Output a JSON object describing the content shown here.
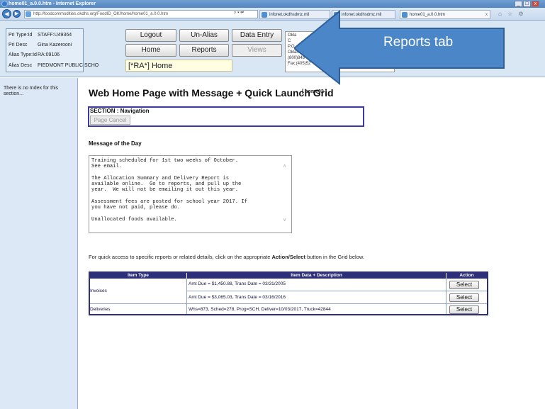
{
  "window": {
    "title": "home01_a.0.0.htm - Internet Explorer",
    "controls": {
      "minimize": "_",
      "maximize": "□",
      "close": "x"
    }
  },
  "browser": {
    "back_icon": "back-arrow-icon",
    "forward_icon": "forward-arrow-icon",
    "address": "http://foodcommodities.okdhs.org/FoodID_OK/home/home01_a.0.0.htm",
    "address_controls": "⌕ ▾  ⇄",
    "tabs": [
      {
        "label": "infonet.okdhsdmz.mil"
      },
      {
        "label": "infonet.okdhsdmz.mil"
      },
      {
        "label": "home01_a.0.0.htm",
        "close": "x"
      }
    ],
    "toolbar_icons": "⌂ ☆ ⚙"
  },
  "header": {
    "user_info": [
      {
        "label": "Pri Type:Id",
        "value": "STAFF:U49364"
      },
      {
        "label": "Pri Desc",
        "value": "Gina Kazerooni"
      },
      {
        "label": "Alias Type:Id",
        "value": "RA:09106"
      },
      {
        "label": "Alias Desc",
        "value": "PIEDMONT PUBLIC SCHO"
      }
    ],
    "buttons": {
      "logout": "Logout",
      "unalias": "Un-Alias",
      "data_entry": "Data Entry",
      "home": "Home",
      "reports": "Reports",
      "views": "Views"
    },
    "home_title": "[*RA*] Home",
    "contact_lines": [
      "Okla",
      "C",
      "P.O.",
      "Oklaho",
      "(800)845",
      "Fax:(405)52"
    ]
  },
  "left_pane": {
    "text": "There is no Index for this section..."
  },
  "main": {
    "page_title": "Web Home Page with Message + Quick Launch Grid",
    "page_code": "[ home02 ]",
    "section_label": "SECTION : Navigation",
    "page_cancel": "Page Cancel",
    "motd_title": "Message of the Day",
    "motd_text": "Training scheduled for 1st two weeks of October.\nSee email.\n\nThe Allocation Summary and Delivery Report is\navailable online.  Go to reports, and pull up the\nyear.  We will not be emailing it out this year.\n\nAssessment fees are posted for school year 2017. If\nyou have not paid, please do.\n\nUnallocated foods available.",
    "motd_scroll_up": "∧",
    "motd_scroll_down": "∨",
    "quick_text_before": "For quick access to specific reports or related details, click on the appropriate ",
    "quick_text_bold": "Action/Select",
    "quick_text_after": " button in the Grid below."
  },
  "grid": {
    "headers": {
      "item_type": "Item Type",
      "item_data": "Item Data + Description",
      "action": "Action"
    },
    "rows": [
      {
        "type": "Invoices",
        "data": "Amt Due = $1,450.88, Trans Date = 03/31/2005",
        "action": "Select"
      },
      {
        "type": "",
        "data": "Amt Due = $3,065.03, Trans Date = 03/16/2016",
        "action": "Select"
      },
      {
        "type": "Deliveries",
        "data": "Whs=873, Sched=278, Prog=SCH, Deliver=10/03/2017, Truck=42844",
        "action": "Select"
      }
    ]
  },
  "annotation": {
    "label": "Reports tab",
    "color": "#4a86c8"
  }
}
